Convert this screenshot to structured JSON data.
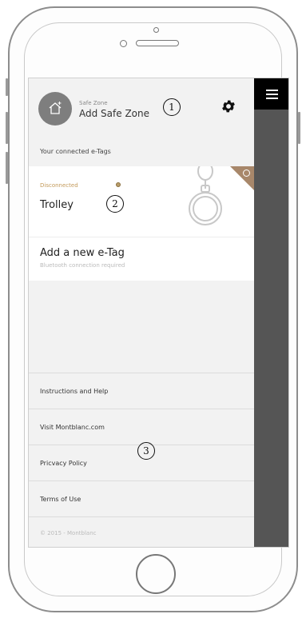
{
  "safe_zone": {
    "label": "Safe Zone",
    "value": "Add Safe Zone"
  },
  "annotations": [
    "1",
    "2",
    "3"
  ],
  "connected_tags": {
    "header": "Your connected e-Tags",
    "tags": [
      {
        "status": "Disconnected",
        "name": "Trolley",
        "status_color": "#c39a5a"
      }
    ]
  },
  "add_tag": {
    "title": "Add a new e-Tag",
    "subtitle": "Bluetooth connection required"
  },
  "links": [
    "Instructions and Help",
    "Visit Montblanc.com",
    "Pricvacy Policy",
    "Terms of Use"
  ],
  "copyright": "© 2015 - Montblanc",
  "icons": {
    "menu": "hamburger-icon",
    "settings": "gear-icon",
    "home": "house-icon"
  }
}
